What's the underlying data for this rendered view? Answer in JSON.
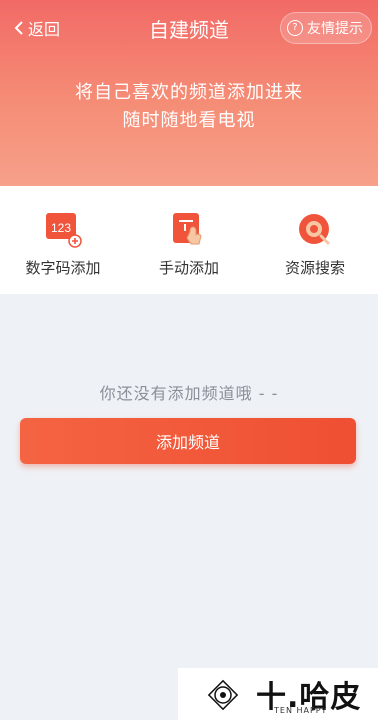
{
  "header": {
    "back_label": "返回",
    "title": "自建频道",
    "tip_label": "友情提示",
    "promo_line1": "将自己喜欢的频道添加进来",
    "promo_line2": "随时随地看电视",
    "bg_color": "#f26a66"
  },
  "actions": [
    {
      "label": "数字码添加",
      "icon": "digit-code-icon",
      "icon_text": "123"
    },
    {
      "label": "手动添加",
      "icon": "hand-tap-icon"
    },
    {
      "label": "资源搜索",
      "icon": "resource-search-icon"
    }
  ],
  "empty_text": "你还没有添加频道哦 - -",
  "add_button_label": "添加频道",
  "accent_color": "#ef4f33",
  "watermark": {
    "name": "十.哈皮",
    "sub": "TEN HAPPY"
  }
}
